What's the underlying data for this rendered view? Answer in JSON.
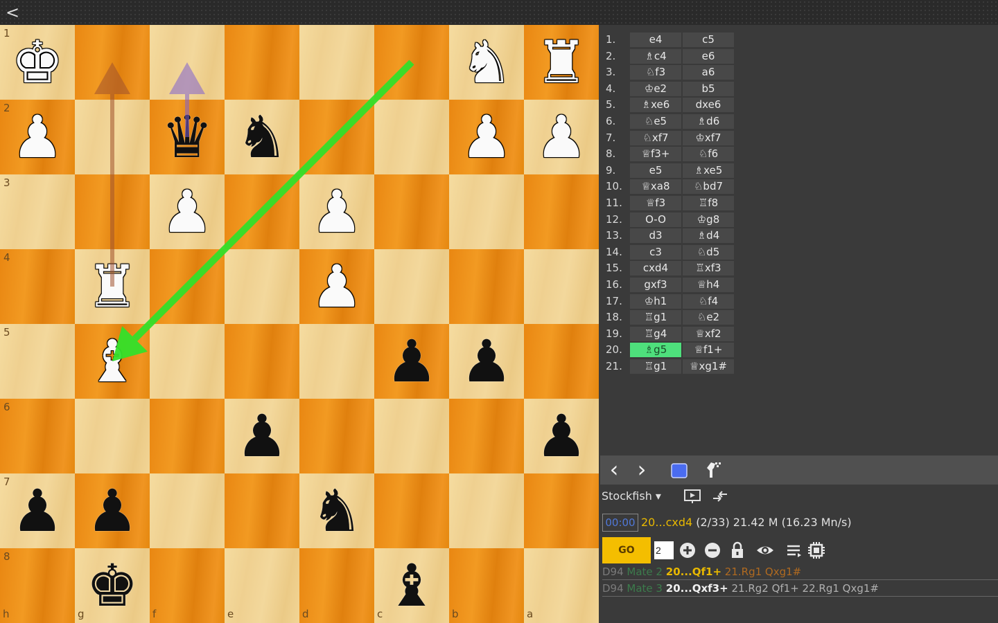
{
  "topbar": {
    "back_icon": "chevron-left-icon",
    "back_glyph": "<"
  },
  "board": {
    "light_color": "#f2d596",
    "dark_color": "#ec8c18",
    "rank_labels": [
      "1",
      "2",
      "3",
      "4",
      "5",
      "6",
      "7",
      "8"
    ],
    "file_labels": [
      "h",
      "g",
      "f",
      "e",
      "d",
      "c",
      "b",
      "a"
    ],
    "pieces": [
      {
        "square": "h1",
        "piece": "king",
        "color": "white",
        "glyph": "♚"
      },
      {
        "square": "b1",
        "piece": "knight",
        "color": "white",
        "glyph": "♞"
      },
      {
        "square": "a1",
        "piece": "rook",
        "color": "white",
        "glyph": "♜"
      },
      {
        "square": "h2",
        "piece": "pawn",
        "color": "white",
        "glyph": "♟"
      },
      {
        "square": "f2",
        "piece": "queen",
        "color": "black",
        "glyph": "♛"
      },
      {
        "square": "e2",
        "piece": "knight",
        "color": "black",
        "glyph": "♞"
      },
      {
        "square": "b2",
        "piece": "pawn",
        "color": "white",
        "glyph": "♟"
      },
      {
        "square": "a2",
        "piece": "pawn",
        "color": "white",
        "glyph": "♟"
      },
      {
        "square": "f3",
        "piece": "pawn",
        "color": "white",
        "glyph": "♟"
      },
      {
        "square": "d3",
        "piece": "pawn",
        "color": "white",
        "glyph": "♟"
      },
      {
        "square": "g4",
        "piece": "rook",
        "color": "white",
        "glyph": "♜"
      },
      {
        "square": "d4",
        "piece": "pawn",
        "color": "white",
        "glyph": "♟"
      },
      {
        "square": "g5",
        "piece": "bishop",
        "color": "white",
        "glyph": "♝"
      },
      {
        "square": "c5",
        "piece": "pawn",
        "color": "black",
        "glyph": "♟"
      },
      {
        "square": "b5",
        "piece": "pawn",
        "color": "black",
        "glyph": "♟"
      },
      {
        "square": "e6",
        "piece": "pawn",
        "color": "black",
        "glyph": "♟"
      },
      {
        "square": "a6",
        "piece": "pawn",
        "color": "black",
        "glyph": "♟"
      },
      {
        "square": "h7",
        "piece": "pawn",
        "color": "black",
        "glyph": "♟"
      },
      {
        "square": "g7",
        "piece": "pawn",
        "color": "black",
        "glyph": "♟"
      },
      {
        "square": "d7",
        "piece": "knight",
        "color": "black",
        "glyph": "♞"
      },
      {
        "square": "g8",
        "piece": "king",
        "color": "black",
        "glyph": "♚"
      },
      {
        "square": "c8",
        "piece": "bishop",
        "color": "black",
        "glyph": "♝"
      }
    ],
    "arrows": [
      {
        "from": "c1",
        "to": "g5",
        "color": "#33e02a"
      },
      {
        "from": "g4",
        "to": "g1",
        "color": "#a0522d"
      },
      {
        "from": "f2",
        "to": "f1",
        "color": "#8060d0"
      }
    ]
  },
  "moves": [
    {
      "num": "1.",
      "white": "e4",
      "black": "c5"
    },
    {
      "num": "2.",
      "white": "♗c4",
      "black": "e6"
    },
    {
      "num": "3.",
      "white": "♘f3",
      "black": "a6"
    },
    {
      "num": "4.",
      "white": "♔e2",
      "black": "b5"
    },
    {
      "num": "5.",
      "white": "♗xe6",
      "black": "dxe6"
    },
    {
      "num": "6.",
      "white": "♘e5",
      "black": "♗d6"
    },
    {
      "num": "7.",
      "white": "♘xf7",
      "black": "♔xf7"
    },
    {
      "num": "8.",
      "white": "♕f3+",
      "black": "♘f6"
    },
    {
      "num": "9.",
      "white": "e5",
      "black": "♗xe5"
    },
    {
      "num": "10.",
      "white": "♕xa8",
      "black": "♘bd7"
    },
    {
      "num": "11.",
      "white": "♕f3",
      "black": "♖f8"
    },
    {
      "num": "12.",
      "white": "O-O",
      "black": "♔g8"
    },
    {
      "num": "13.",
      "white": "d3",
      "black": "♗d4"
    },
    {
      "num": "14.",
      "white": "c3",
      "black": "♘d5"
    },
    {
      "num": "15.",
      "white": "cxd4",
      "black": "♖xf3"
    },
    {
      "num": "16.",
      "white": "gxf3",
      "black": "♕h4"
    },
    {
      "num": "17.",
      "white": "♔h1",
      "black": "♘f4"
    },
    {
      "num": "18.",
      "white": "♖g1",
      "black": "♘e2"
    },
    {
      "num": "19.",
      "white": "♖g4",
      "black": "♕xf2"
    },
    {
      "num": "20.",
      "white": "♗g5",
      "black": "♕f1+"
    },
    {
      "num": "21.",
      "white": "♖g1",
      "black": "♕xg1#"
    }
  ],
  "selected_move": {
    "index": 19,
    "side": "white"
  },
  "navbar": {
    "prev_glyph": "‹",
    "next_glyph": "›",
    "stop_color": "#4a6cf0"
  },
  "engine": {
    "name": "Stockfish ▾",
    "time": "00:00",
    "pv_move": "20...cxd4",
    "pv_rest": " (2/33) 21.42 M (16.23 Mn/s)"
  },
  "controls": {
    "go_label": "GO",
    "depth_value": "2"
  },
  "pv_lines": [
    {
      "tag": "D94",
      "mate": "Mate 2",
      "first": "20...Qf1+",
      "rest": " 21.Rg1 Qxg1#"
    },
    {
      "tag": "D94",
      "mate": "Mate 3",
      "first": "20...Qxf3+",
      "rest": " 21.Rg2 Qf1+ 22.Rg1 Qxg1#"
    }
  ]
}
